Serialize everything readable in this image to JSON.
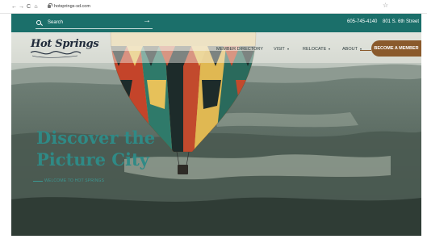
{
  "browser": {
    "back": "←",
    "forward": "→",
    "reload": "C",
    "home": "⌂",
    "url": "hotsprings-sd.com",
    "star": "☆"
  },
  "utility": {
    "search_label": "Search",
    "search_arrow": "→",
    "phone": "605-745-4140",
    "address": "801 S. 6th Street"
  },
  "logo": {
    "text": "Hot Springs"
  },
  "nav": {
    "items": [
      {
        "label": "MEMBER DIRECTORY"
      },
      {
        "label": "VISIT"
      },
      {
        "label": "RELOCATE"
      },
      {
        "label": "ABOUT"
      }
    ],
    "cta": "BECOME A MEMBER"
  },
  "hero": {
    "heading_line1": "Discover the",
    "heading_line2": "Picture City",
    "subheading": "WELCOME TO HOT SPRINGS"
  },
  "colors": {
    "utility_bar": "#1b6f6a",
    "heading": "#2f8a86",
    "cta": "#8a5a2c"
  },
  "icons": [
    "back-arrow-icon",
    "forward-arrow-icon",
    "reload-icon",
    "home-icon",
    "lock-icon",
    "bookmark-star-icon",
    "search-icon",
    "arrow-right-icon",
    "chevron-down-icon"
  ]
}
